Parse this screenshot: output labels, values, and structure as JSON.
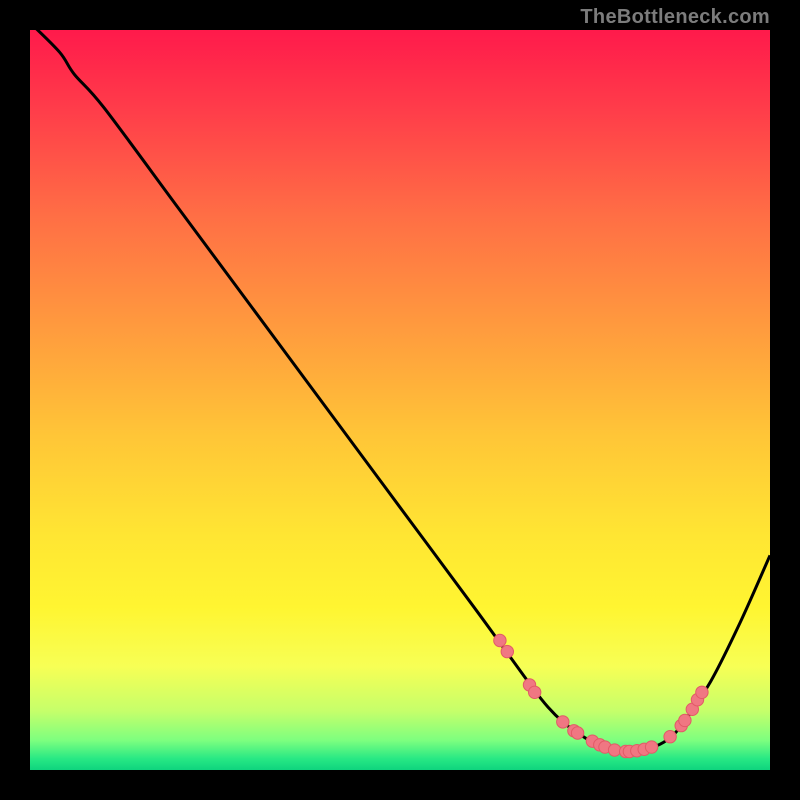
{
  "attribution": "TheBottleneck.com",
  "colors": {
    "black": "#000000",
    "curve": "#000000",
    "marker_fill": "#f07782",
    "marker_stroke": "#e25a67",
    "gradient_stops": [
      {
        "offset": 0.0,
        "color": "#ff1a4b"
      },
      {
        "offset": 0.1,
        "color": "#ff3a4a"
      },
      {
        "offset": 0.25,
        "color": "#ff6e45"
      },
      {
        "offset": 0.4,
        "color": "#ff9a3e"
      },
      {
        "offset": 0.55,
        "color": "#ffc637"
      },
      {
        "offset": 0.68,
        "color": "#ffe533"
      },
      {
        "offset": 0.78,
        "color": "#fff531"
      },
      {
        "offset": 0.86,
        "color": "#f7ff55"
      },
      {
        "offset": 0.92,
        "color": "#c6ff6a"
      },
      {
        "offset": 0.96,
        "color": "#7dff7f"
      },
      {
        "offset": 0.985,
        "color": "#27e884"
      },
      {
        "offset": 1.0,
        "color": "#0fd47e"
      }
    ]
  },
  "chart_data": {
    "type": "line",
    "title": "",
    "xlabel": "",
    "ylabel": "",
    "xlim": [
      0,
      100
    ],
    "ylim": [
      0,
      100
    ],
    "grid": false,
    "legend": false,
    "series": [
      {
        "name": "curve",
        "x": [
          0,
          4,
          6,
          10,
          20,
          30,
          40,
          50,
          60,
          64,
          68,
          70,
          72,
          74,
          76,
          78,
          80,
          82,
          84,
          86,
          88,
          92,
          96,
          100
        ],
        "y": [
          101,
          97,
          94,
          89.5,
          76,
          62.5,
          49,
          35.5,
          22,
          16.5,
          11,
          8.5,
          6.5,
          5,
          3.8,
          3,
          2.5,
          2.5,
          3,
          4,
          6,
          12,
          20,
          29
        ]
      }
    ],
    "markers": [
      {
        "x": 63.5,
        "y": 17.5
      },
      {
        "x": 64.5,
        "y": 16.0
      },
      {
        "x": 67.5,
        "y": 11.5
      },
      {
        "x": 68.2,
        "y": 10.5
      },
      {
        "x": 72.0,
        "y": 6.5
      },
      {
        "x": 73.5,
        "y": 5.3
      },
      {
        "x": 74.0,
        "y": 5.0
      },
      {
        "x": 76.0,
        "y": 3.9
      },
      {
        "x": 77.0,
        "y": 3.4
      },
      {
        "x": 77.7,
        "y": 3.1
      },
      {
        "x": 79.0,
        "y": 2.7
      },
      {
        "x": 80.5,
        "y": 2.5
      },
      {
        "x": 81.0,
        "y": 2.5
      },
      {
        "x": 82.0,
        "y": 2.6
      },
      {
        "x": 83.0,
        "y": 2.8
      },
      {
        "x": 84.0,
        "y": 3.1
      },
      {
        "x": 86.5,
        "y": 4.5
      },
      {
        "x": 88.0,
        "y": 6.0
      },
      {
        "x": 88.5,
        "y": 6.7
      },
      {
        "x": 89.5,
        "y": 8.2
      },
      {
        "x": 90.2,
        "y": 9.5
      },
      {
        "x": 90.8,
        "y": 10.5
      }
    ]
  }
}
